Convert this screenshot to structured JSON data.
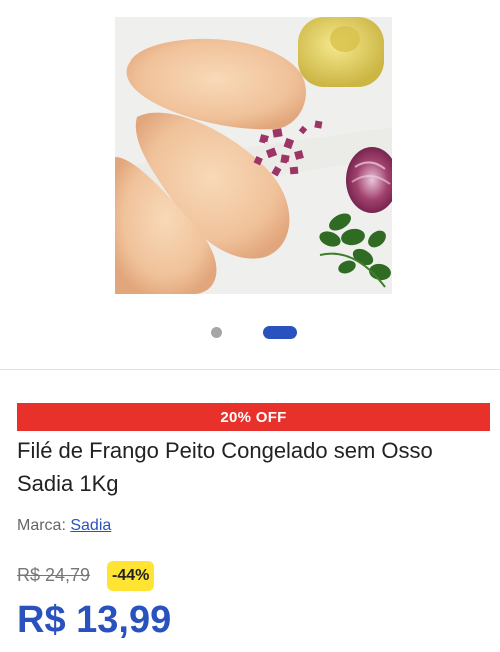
{
  "gallery": {
    "image_alt": "Filé de Frango Peito Congelado sem Osso Sadia 1Kg",
    "slide_count": 2,
    "active_slide": 2
  },
  "product": {
    "discount_banner": "20% OFF",
    "title": "Filé de Frango Peito Congelado sem Osso Sadia 1Kg",
    "brand_label": "Marca:",
    "brand_name": "Sadia",
    "old_price": "R$ 24,79",
    "discount_percent": "-44%",
    "price": "R$ 13,99"
  },
  "colors": {
    "accent_blue": "#2a52be",
    "banner_red": "#e8312a",
    "badge_yellow": "#ffe433",
    "dot_inactive": "#a6a6a6"
  }
}
